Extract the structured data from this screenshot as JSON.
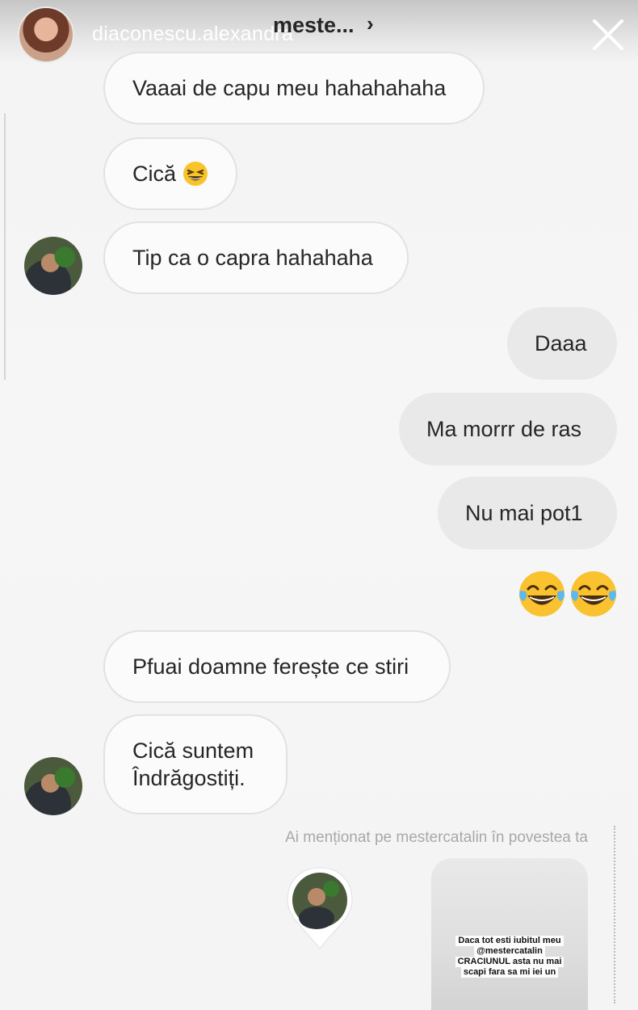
{
  "header": {
    "story_username": "diaconescu.alexandra",
    "chat_title": "meste...",
    "chevron": "›",
    "close_icon": "close-icon"
  },
  "messages": [
    {
      "direction": "incoming",
      "text": "Vaaai de capu meu hahahahaha"
    },
    {
      "direction": "incoming",
      "text": "Cică",
      "emoji": "grinning-squinting-face"
    },
    {
      "direction": "incoming",
      "text": "Tip ca o capra hahahaha"
    },
    {
      "direction": "outgoing",
      "text": "Daaa"
    },
    {
      "direction": "outgoing",
      "text": "Ma morrr de ras"
    },
    {
      "direction": "outgoing",
      "text": "Nu mai pot1"
    },
    {
      "direction": "outgoing",
      "emoji": [
        "face-with-tears-of-joy",
        "face-with-tears-of-joy"
      ]
    },
    {
      "direction": "incoming",
      "text": "Pfuai doamne ferește ce stiri"
    },
    {
      "direction": "incoming",
      "line1": "Cică suntem",
      "line2": "Îndrăgostiți."
    }
  ],
  "mention": {
    "note": "Ai menționat pe mestercatalin în povestea ta",
    "story_caption": [
      "Daca tot esti iubitul meu",
      "@mestercatalin",
      "CRACIUNUL asta nu mai",
      "scapi fara sa mi iei un"
    ]
  }
}
